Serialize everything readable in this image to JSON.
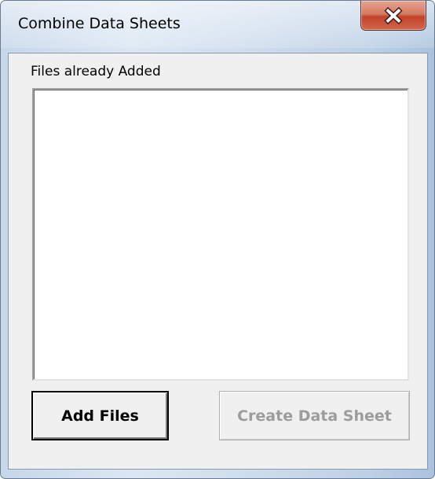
{
  "window": {
    "title": "Combine Data Sheets"
  },
  "files_list": {
    "label": "Files already Added",
    "items": []
  },
  "buttons": {
    "add_files": "Add Files",
    "create_data_sheet": "Create Data Sheet"
  },
  "colors": {
    "close_button": "#c7472e",
    "client_bg": "#f0f0f0",
    "disabled_text": "#9c9c9c"
  },
  "icons": {
    "close": "close-icon"
  }
}
